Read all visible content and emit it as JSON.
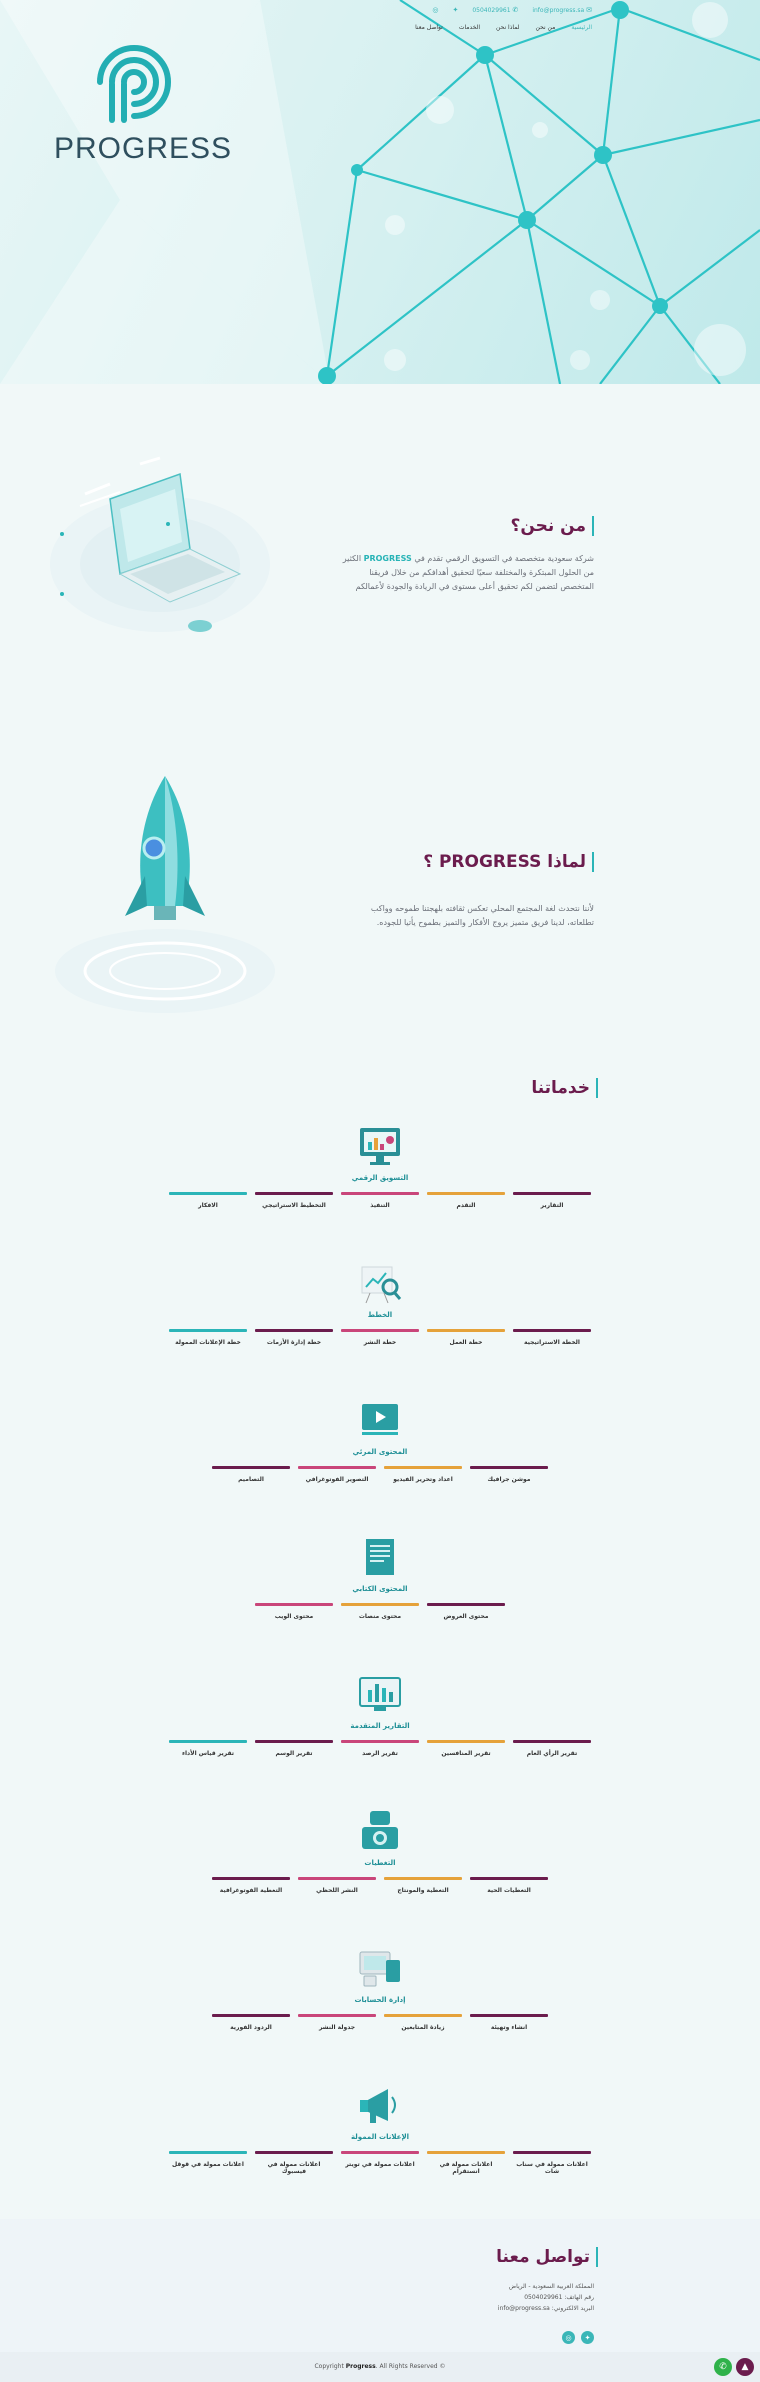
{
  "brand": {
    "name": "PROGRESS",
    "teal": "#2bb5b8",
    "purple": "#6b1c4d"
  },
  "topbar": {
    "email": "info@progress.sa",
    "phone": "0504029961",
    "email_icon": "mail-icon",
    "phone_icon": "phone-icon",
    "social_icons": [
      "twitter-icon",
      "instagram-icon"
    ]
  },
  "nav": [
    "الرئيسية",
    "من نحن",
    "لماذا نحن",
    "الخدمات",
    "تواصل معنا"
  ],
  "about": {
    "title": "من نحن؟",
    "text_a": "شركة سعودية متخصصة في التسويق الرقمي تقدم في ",
    "text_brand": "PROGRESS",
    "text_b": " الكثير من الحلول المبتكرة والمختلفة سعيًا لتحقيق أهدافكم من خلال فريقنا المتخصص لتضمن لكم تحقيق أعلى مستوى في الريادة والجودة لأعمالكم"
  },
  "why": {
    "title": "لماذا PROGRESS ؟",
    "text": "لأننا نتحدث لغة المجتمع المحلي تعكس ثقافته بلهجتنا طموحه وواكب تطلعاته، لدينا فريق متميز يروج الأفكار والتميز بطموح يأتيا للجوده."
  },
  "services": {
    "title": "خدماتنا",
    "categories": [
      {
        "title": "التسويق الرقمي",
        "icon": "monitor-chart-icon",
        "items": [
          "التقارير",
          "التقدم",
          "التنفيذ",
          "التخطيط الاستراتيجي",
          "الافكار"
        ]
      },
      {
        "title": "الخطط",
        "icon": "presentation-magnifier-icon",
        "items": [
          "الخطة الاستراتيجية",
          "خطة العمل",
          "خطة النشر",
          "خطة إدارة الأزمات",
          "خطة الإعلانات الممولة"
        ]
      },
      {
        "title": "المحتوى المرئي",
        "icon": "video-player-icon",
        "items": [
          "موشن جرافيك",
          "اعداد وتحرير الفيديو",
          "التصوير الفوتوغرافي",
          "التصاميم"
        ]
      },
      {
        "title": "المحتوى الكتابي",
        "icon": "document-icon",
        "items": [
          "محتوى العروض",
          "محتوى منصات",
          "محتوى الويب"
        ]
      },
      {
        "title": "التقارير المتقدمة",
        "icon": "report-screen-icon",
        "items": [
          "تقرير الرأي العام",
          "تقرير المنافسين",
          "تقرير الرصد",
          "تقرير الوسم",
          "تقرير قياس الأداء"
        ]
      },
      {
        "title": "التغطيات",
        "icon": "camera-icon",
        "items": [
          "التغطيات الحية",
          "التغطية والمونتاج",
          "النشر اللحظي",
          "التغطية الفوتوغرافية"
        ]
      },
      {
        "title": "إدارة الحسابات",
        "icon": "devices-icon",
        "items": [
          "انشاء وتهيئة",
          "زيادة المتابعين",
          "جدولة النشر",
          "الردود الفورية"
        ]
      },
      {
        "title": "الإعلانات الممولة",
        "icon": "megaphone-icon",
        "items": [
          "اعلانات ممولة في سناب شات",
          "اعلانات ممولة في انستقرام",
          "اعلانات ممولة في تويتر",
          "اعلانات ممولة في فيسبوك",
          "اعلانات ممولة في قوقل"
        ]
      }
    ],
    "bar_colors": [
      "#6b1c4d",
      "#e5a23a",
      "#c9467a",
      "#6b1c4d",
      "#2bb5b8"
    ]
  },
  "contact": {
    "title": "تواصل معنا",
    "lines": [
      "المملكة العربية السعودية - الرياض",
      "رقم الهاتف: 0504029961",
      "البريد الالكتروني: info@progress.sa"
    ],
    "social_icons": [
      "instagram-icon",
      "twitter-icon"
    ]
  },
  "footer": {
    "prefix": "Copyright ",
    "brand": "Progress",
    "suffix": ". All Rights Reserved ©"
  },
  "floating": {
    "whatsapp": "whatsapp-icon",
    "top": "arrow-up-icon",
    "whatsapp_color": "#2fb24a"
  }
}
